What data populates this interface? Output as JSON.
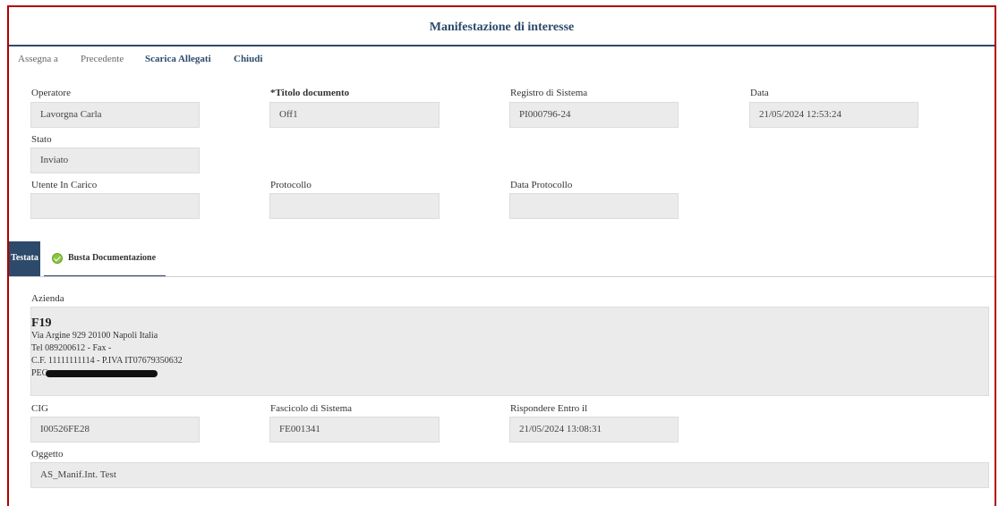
{
  "title": "Manifestazione di interesse",
  "toolbar": {
    "assegna": "Assegna a",
    "precedente": "Precedente",
    "scarica": "Scarica Allegati",
    "chiudi": "Chiudi"
  },
  "header_fields": {
    "operatore": {
      "label": "Operatore",
      "value": "Lavorgna Carla"
    },
    "titolo": {
      "label": "*Titolo documento",
      "value": "Off1"
    },
    "registro": {
      "label": "Registro di Sistema",
      "value": "PI000796-24"
    },
    "data": {
      "label": "Data",
      "value": "21/05/2024 12:53:24"
    },
    "stato": {
      "label": "Stato",
      "value": "Inviato"
    },
    "utente": {
      "label": "Utente In Carico",
      "value": ""
    },
    "protocollo": {
      "label": "Protocollo",
      "value": ""
    },
    "data_protocollo": {
      "label": "Data Protocollo",
      "value": ""
    }
  },
  "tabs": {
    "testata": "Testata",
    "busta": "Busta Documentazione"
  },
  "azienda": {
    "label": "Azienda",
    "name": "F19",
    "address": "Via Argine 929 20100 Napoli Italia",
    "tel": "Tel 089200612 - Fax -",
    "cf": "C.F. 11111111114 - P.IVA IT07679350632",
    "pec_label": "PEC"
  },
  "detail_fields": {
    "cig": {
      "label": "CIG",
      "value": "I00526FE28"
    },
    "fascicolo": {
      "label": "Fascicolo di Sistema",
      "value": "FE001341"
    },
    "rispondere": {
      "label": "Rispondere Entro il",
      "value": "21/05/2024 13:08:31"
    },
    "oggetto": {
      "label": "Oggetto",
      "value": "AS_Manif.Int. Test"
    }
  },
  "icons": {
    "busta_tab": "check-circle-icon"
  },
  "colors": {
    "accent": "#2d4a6b",
    "frame": "#b30000",
    "field_bg": "#ebebeb",
    "check": "#8cc63f"
  }
}
